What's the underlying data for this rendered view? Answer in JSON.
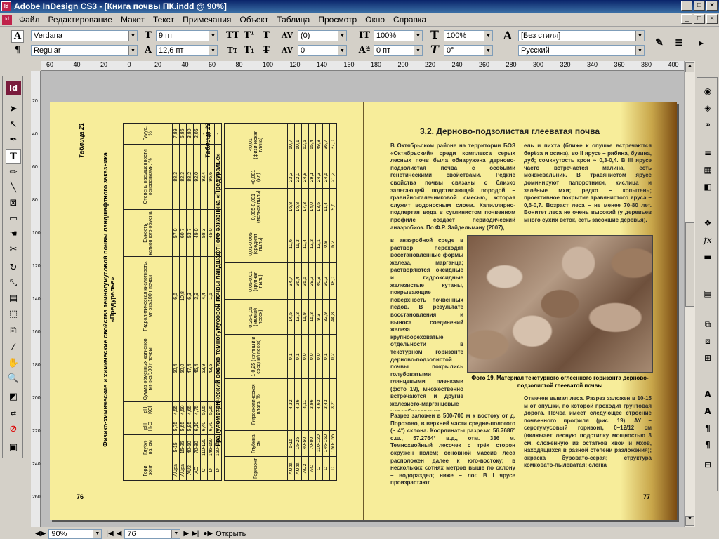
{
  "window": {
    "title": "Adobe InDesign CS3 - [Книга почвы ПК.indd @ 90%]",
    "app_icon": "Id",
    "min": "_",
    "max": "□",
    "close": "×"
  },
  "menu": [
    "Файл",
    "Редактирование",
    "Макет",
    "Текст",
    "Примечания",
    "Объект",
    "Таблица",
    "Просмотр",
    "Окно",
    "Справка"
  ],
  "control": {
    "font": "Verdana",
    "style": "Regular",
    "size": "9 пт",
    "leading": "12,6 пт",
    "tracking": "(0)",
    "kerning": "0",
    "hscale": "100%",
    "vscale": "100%",
    "baseline": "0 пт",
    "skew": "0°",
    "para_style": "[Без стиля]",
    "language": "Русский"
  },
  "ruler_h": [
    "60",
    "40",
    "20",
    "0",
    "20",
    "40",
    "60",
    "80",
    "100",
    "120",
    "140",
    "160",
    "180",
    "200",
    "220",
    "240",
    "260",
    "280",
    "300",
    "320",
    "340",
    "360",
    "380",
    "400"
  ],
  "ruler_v": [
    "20",
    "40",
    "60",
    "80",
    "100",
    "120",
    "140",
    "160",
    "180",
    "200",
    "220",
    "240",
    "260"
  ],
  "status": {
    "zoom": "90%",
    "page": "76",
    "open": "Открыть"
  },
  "left_page": {
    "table21_label": "Таблица 21",
    "table21_title": "Физико-химические и химические свойства темногумусовой почвы ландшафтного заказника «Предуралье»",
    "table21_headers": [
      "Гори-зонт",
      "Глуби-на, см",
      "рН H₂O",
      "рН KCl",
      "Сумма обменных катионов, мг-экв/100 г почвы",
      "Гидролитическая кислотность, мг-экв/100 г почвы",
      "Ёмкость катионного обмена",
      "Степень насыщенности основаниями, %",
      "Гумус, %"
    ],
    "table21_rows": [
      [
        "AUpa",
        "5-15",
        "5,75",
        "4,55",
        "50,4",
        "6,6",
        "57,0",
        "88,3",
        "7,89"
      ],
      [
        "AUpa",
        "15-25",
        "5,65",
        "4,50",
        "50,0",
        "10,8",
        "60,7",
        "82,3",
        "5,86"
      ],
      [
        "AU2",
        "40-50",
        "5,85",
        "4,65",
        "47,4",
        "6,3",
        "53,7",
        "88,2",
        "3,80"
      ],
      [
        "AC",
        "70-80",
        "6,10",
        "4,75",
        "45,4",
        "3,9",
        "49,0",
        "92,0",
        "2,05"
      ],
      [
        "C",
        "110-120",
        "6,40",
        "5,05",
        "53,9",
        "4,4",
        "58,3",
        "92,4",
        "-"
      ],
      [
        "D",
        "146-150",
        "6,70",
        "5,25",
        "43,5",
        "1,5",
        "45,0",
        "96,6",
        "-"
      ],
      [
        "D",
        "150-155",
        "6,50",
        "5,00",
        "43,9",
        "2,6",
        "46,5",
        "94,3",
        "-"
      ]
    ],
    "table22_label": "Таблица 22",
    "table22_title": "Гранулометрический состав темногумусовой почвы ландшафтного заказника «Предуралье»",
    "table22_headers": [
      "Горизонт",
      "Глубина, см",
      "Гигроскопическая влага, %",
      "1-0,25 (крупный и средний песок)",
      "0,25-0,05 (мелкий песок)",
      "0,05-0,01 (крупная пыль)",
      "0,01-0,005 (средняя пыль)",
      "0,005-0,001 (мелкая пыль)",
      "<0,001 (ил)",
      "<0,01 (физическая глина)"
    ],
    "table22_rows": [
      [
        "AUpa",
        "5-15",
        "4,32",
        "0,1",
        "14,5",
        "34,7",
        "10,6",
        "16,8",
        "23,2",
        "50,7"
      ],
      [
        "AUpa",
        "15-25",
        "4,36",
        "0,1",
        "13,3",
        "36,4",
        "11,3",
        "16,8",
        "22,0",
        "50,1"
      ],
      [
        "AU2",
        "40-50",
        "4,11",
        "0,0",
        "11,9",
        "35,6",
        "10,4",
        "17,3",
        "24,8",
        "52,5"
      ],
      [
        "AC",
        "70-80",
        "3,96",
        "0,0",
        "15,3",
        "29,2",
        "12,3",
        "14,0",
        "29,1",
        "55,4"
      ],
      [
        "C",
        "110-120",
        "4,63",
        "0,0",
        "9,3",
        "40,9",
        "12,1",
        "13,5",
        "24,3",
        "49,8"
      ],
      [
        "D",
        "146-150",
        "3,43",
        "0,1",
        "32,9",
        "30,2",
        "0,8",
        "11,4",
        "24,5",
        "36,7"
      ],
      [
        "D",
        "150-155",
        "3,21",
        "0,2",
        "44,8",
        "18,0",
        "6,2",
        "9,6",
        "21,2",
        "37,0"
      ]
    ],
    "page_number": "76"
  },
  "right_page": {
    "heading": "3.2. Дерново-подзолистая глееватая почва",
    "col1_top": "В Октябрьском районе на территории БОЗ «Октябрьский» среди комплекса серых лесных почв была обнаружена дерново-подзолистая почва с особыми генетическими свойствами. Редкие свойства почвы связаны с близко залегающей подстилающей породой – гравийно-галечниковой смесью, которая служит водоносным слоем. Капиллярно-подпертая вода в суглинистом почвенном профиле создает периодический анаэробиоз. По Ф.Р. Зайдельману (2007),",
    "col1_narrow": "в анаэробной среде в раствор переходят восстановленные формы железа, марганца; растворяются оксидные и гидроксидные железистые кутаны, покрывающие поверхность почвенных педов. В результате восстановления и выноса соединений железа крупноореховатые отдельности в текстурном горизонте дерново-подзолистой почвы покрылись голубоватыми глянцевыми пленками (фото 19), множественно встречаются и другие железисто-марганцевые новообразования.",
    "col1_bottom": "Разрез заложен в 500-700 м к востоку от д. Порозово, в верхней части средне-пологого (~ 4°) склона. Координаты разреза: 56.7686° с.ш., 57.2764° в.д., отм. 336 м. Темнохвойный лесочек с трёх сторон окружён полем; основной массив леса расположен далее к юго-востоку; в нескольких сотнях метров выше по склону – водораздел; ниже – лог. В I ярусе произрастают",
    "col2_top": "ель и пихта (ближе к опушке встречаются берёза и осина), во II ярусе – рябина, бузина, дуб; сомкнутость крон ~ 0,3-0,4. В III ярусе часто встречается малина, есть можжевельник. В травянистом ярусе доминируют папоротники, кислица и зелёные мхи; редко – копытень; проективное покрытие травянистого яруса ~ 0,6-0,7. Возраст леса – не менее 70-80 лет. Бонитет леса не очень высокий (у деревьев много сухих веток, есть засохшие деревья).",
    "col2_bottom": "Отмечен вывал леса. Разрез заложен в 10-15 м от опушки, по которой проходит грунтовая дорога. Почва имеет следующее строение почвенного профиля (рис. 19). AY – серогумусовый горизонт, 0–12/12 см (включает лесную подстилку мощностью 3 см, сложенную из остатков хвои и мхов, находящихся в разной степени разложения); окраска буровато-серая; структура комковато-пылеватая; слегка",
    "caption": "Фото 19. Материал текстурного оглеенного горизонта дерново-подзолистой глееватой почвы",
    "page_number": "77"
  }
}
